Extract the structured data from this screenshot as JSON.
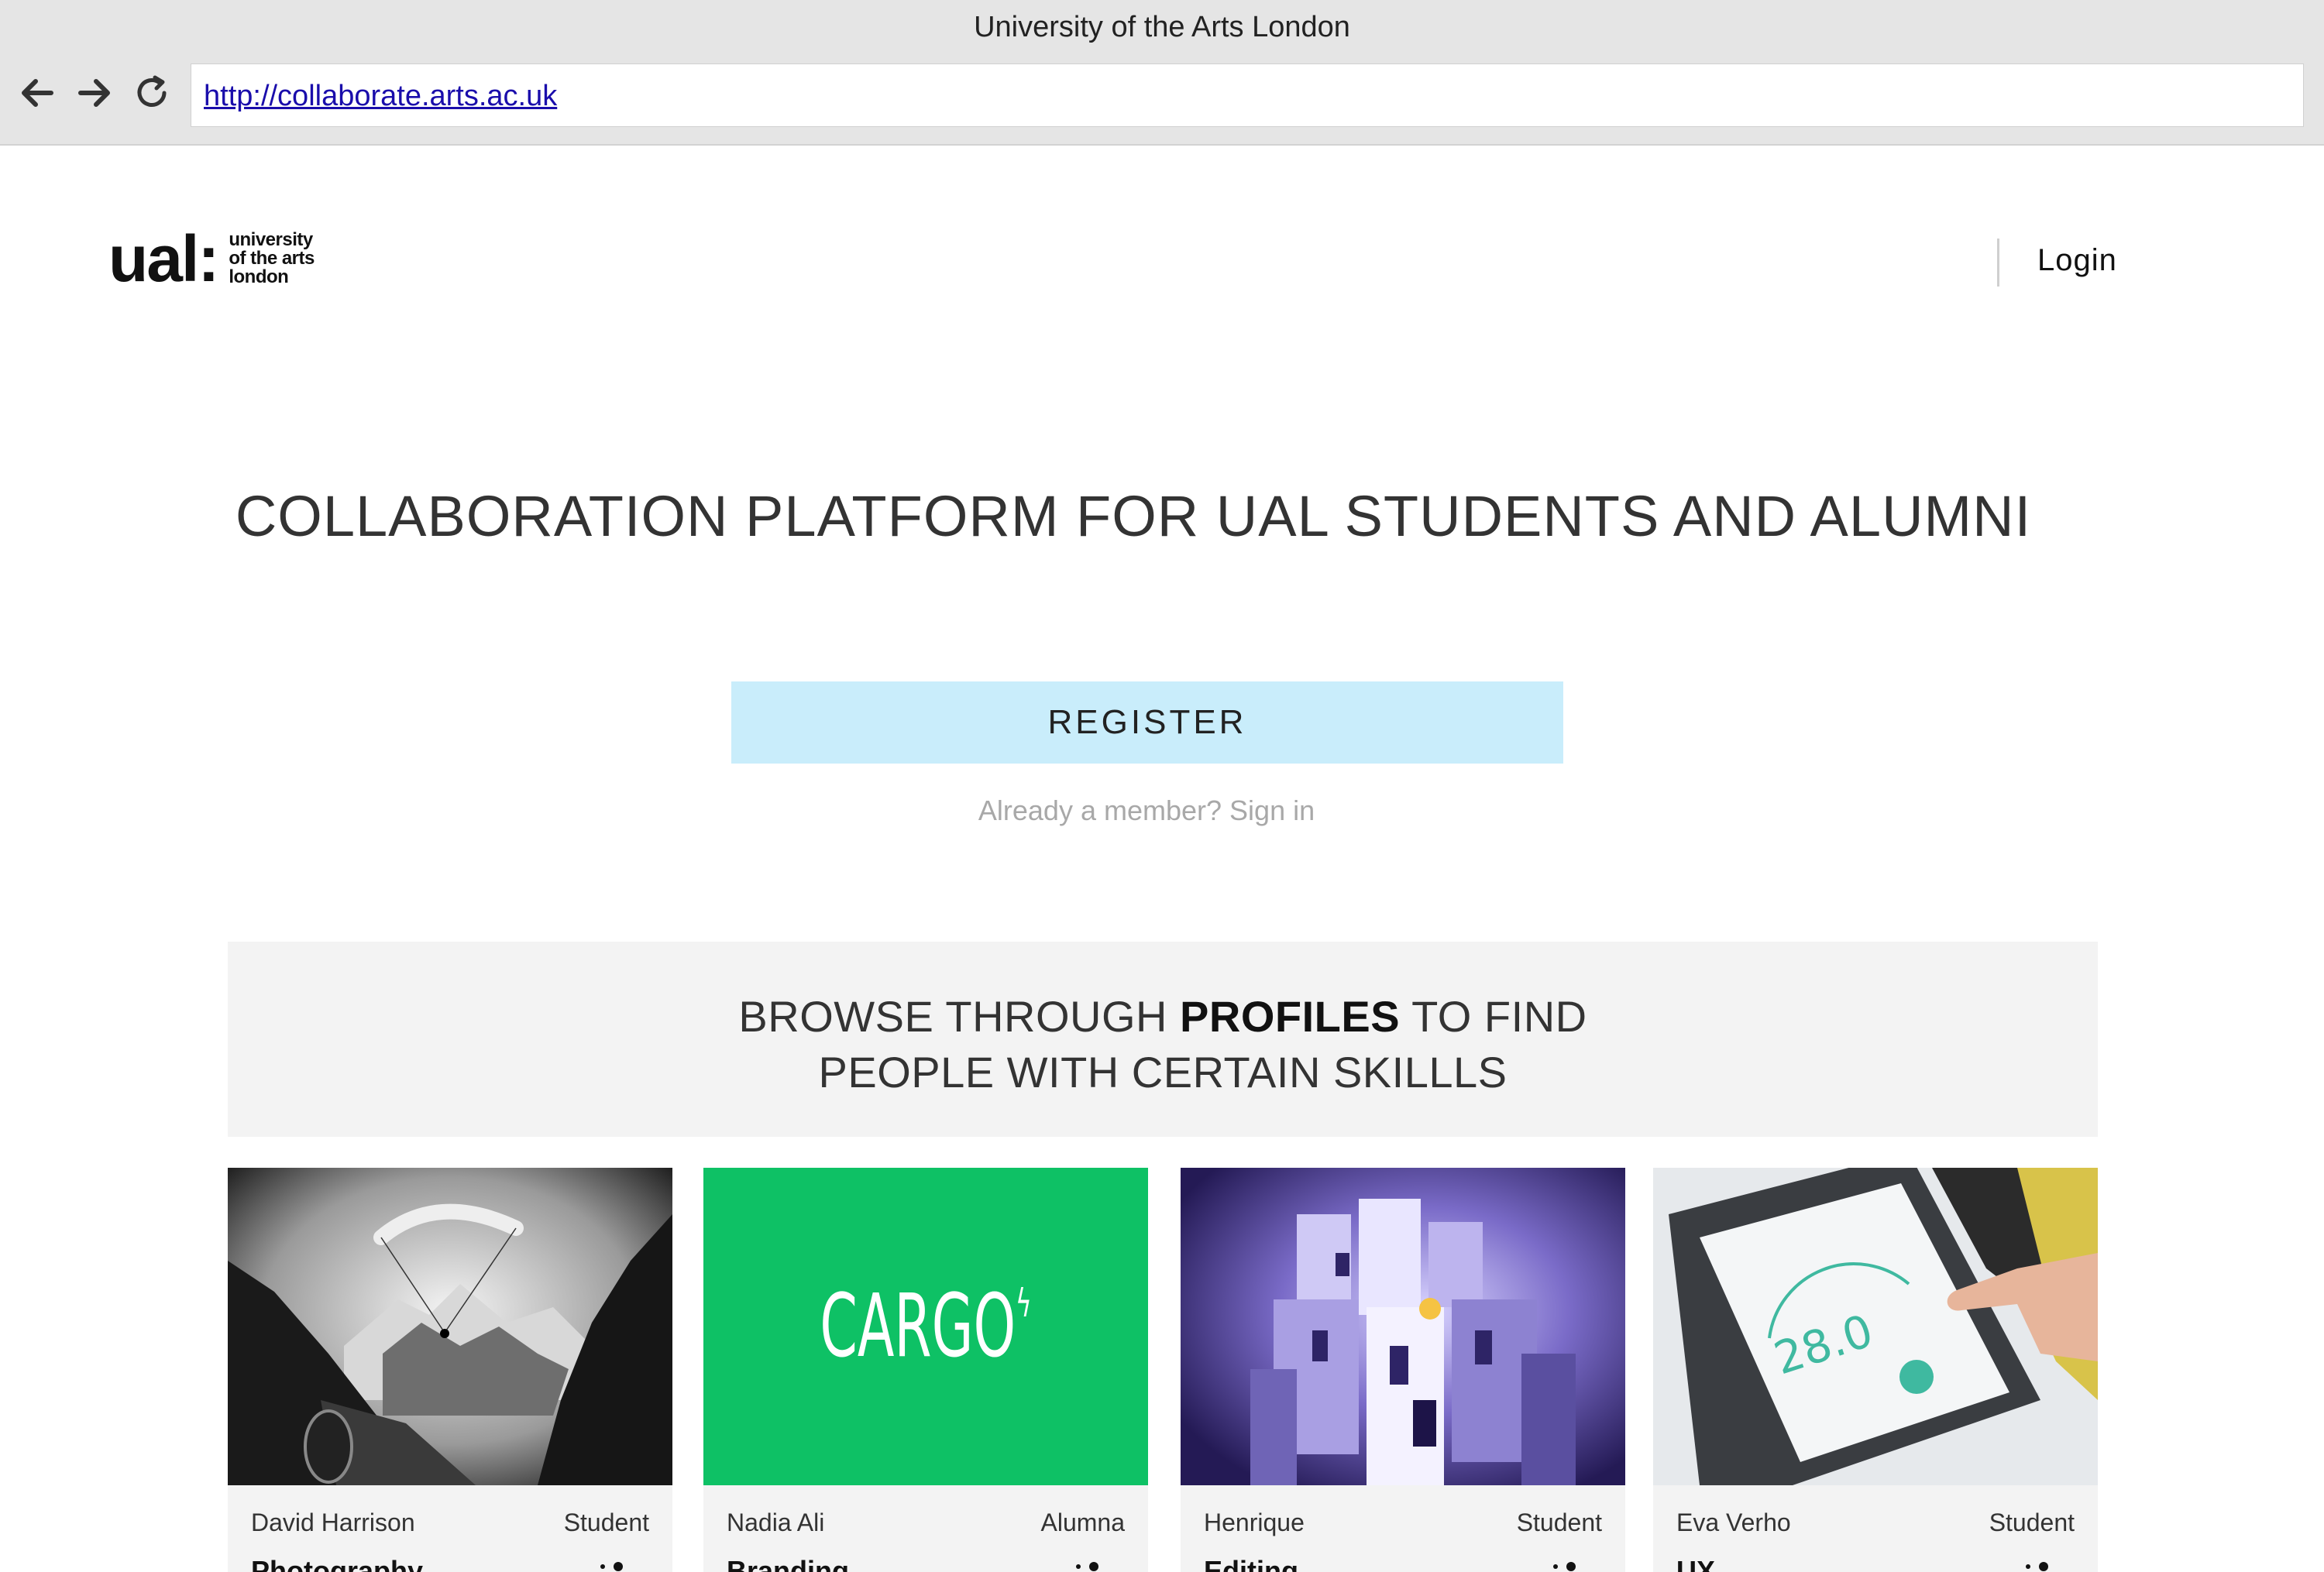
{
  "browser": {
    "window_title": "University of the Arts London",
    "url": "http://collaborate.arts.ac.uk",
    "icons": [
      "back-arrow-icon",
      "forward-arrow-icon",
      "reload-icon"
    ]
  },
  "header": {
    "logo_mark": "ual:",
    "logo_lines": [
      "university",
      "of the arts",
      "london"
    ],
    "login_label": "Login"
  },
  "hero": {
    "title": "COLLABORATION PLATFORM FOR UAL STUDENTS AND ALUMNI",
    "register_label": "REGISTER",
    "signin_text": "Already a member? Sign in"
  },
  "browse": {
    "line1_before": "BROWSE THROUGH ",
    "line1_bold": "PROFILES",
    "line1_after": " TO FIND",
    "line2": "PEOPLE WITH CERTAIN SKILLLS"
  },
  "profiles": [
    {
      "name": "David Harrison",
      "role": "Student",
      "skill": "Photography",
      "image": "paraglider-mountains-photo"
    },
    {
      "name": "Nadia Ali",
      "role": "Alumna",
      "skill": "Branding",
      "image": "cargo-logo",
      "image_text": "CARGO"
    },
    {
      "name": "Henrique",
      "role": "Student",
      "skill": "Editing",
      "image": "paper-city-model-photo"
    },
    {
      "name": "Eva Verho",
      "role": "Student",
      "skill": "UX",
      "image": "thermostat-touch-photo",
      "image_text": "28.0"
    }
  ],
  "colors": {
    "register_bg": "#c9edfb",
    "cargo_green": "#0ec165",
    "panel_bg": "#f3f3f3",
    "link_blue": "#1a0dab"
  }
}
